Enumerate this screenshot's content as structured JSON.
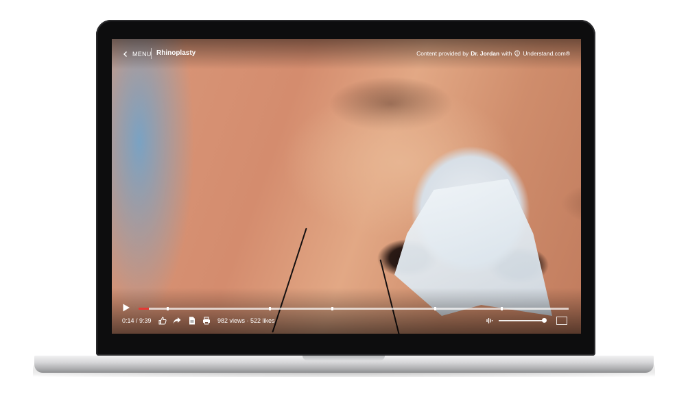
{
  "header": {
    "menu_label": "MENU",
    "title": "Rhinoplasty",
    "provider_prefix": "Content provided by",
    "provider_name": "Dr. Jordan",
    "provider_with": "with",
    "provider_brand": "Understand.com®"
  },
  "player": {
    "time": "0:14 / 9:39",
    "stats": "982 views · 522 likes",
    "progress_percent": 2.4,
    "volume_percent": 100,
    "accent_color": "#e53935"
  },
  "icons": {
    "back": "chevron-left-icon",
    "play": "play-icon",
    "like": "thumbs-up-icon",
    "share": "share-arrow-icon",
    "document": "document-icon",
    "print": "printer-icon",
    "volume": "waveform-icon",
    "fullscreen": "fullscreen-icon"
  }
}
